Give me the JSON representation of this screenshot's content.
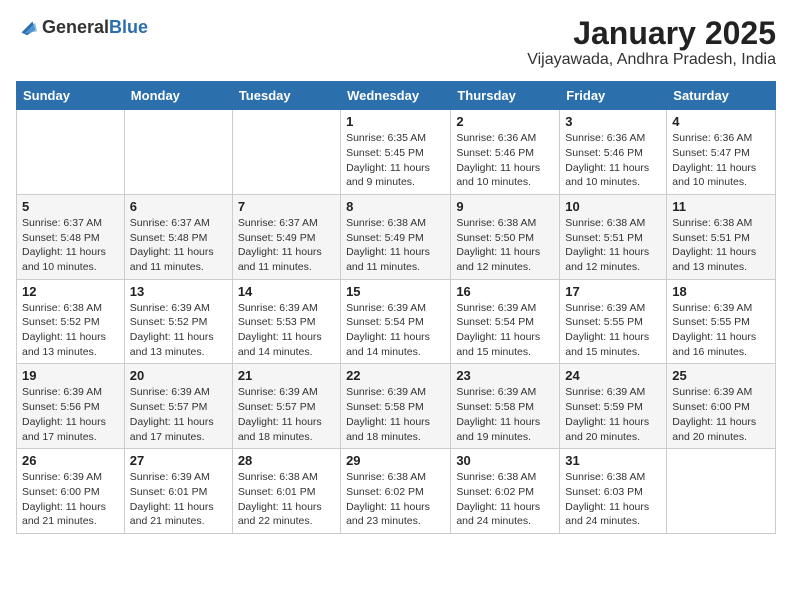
{
  "header": {
    "logo_general": "General",
    "logo_blue": "Blue",
    "title": "January 2025",
    "subtitle": "Vijayawada, Andhra Pradesh, India"
  },
  "days_of_week": [
    "Sunday",
    "Monday",
    "Tuesday",
    "Wednesday",
    "Thursday",
    "Friday",
    "Saturday"
  ],
  "weeks": [
    [
      {
        "day": "",
        "info": ""
      },
      {
        "day": "",
        "info": ""
      },
      {
        "day": "",
        "info": ""
      },
      {
        "day": "1",
        "info": "Sunrise: 6:35 AM\nSunset: 5:45 PM\nDaylight: 11 hours\nand 9 minutes."
      },
      {
        "day": "2",
        "info": "Sunrise: 6:36 AM\nSunset: 5:46 PM\nDaylight: 11 hours\nand 10 minutes."
      },
      {
        "day": "3",
        "info": "Sunrise: 6:36 AM\nSunset: 5:46 PM\nDaylight: 11 hours\nand 10 minutes."
      },
      {
        "day": "4",
        "info": "Sunrise: 6:36 AM\nSunset: 5:47 PM\nDaylight: 11 hours\nand 10 minutes."
      }
    ],
    [
      {
        "day": "5",
        "info": "Sunrise: 6:37 AM\nSunset: 5:48 PM\nDaylight: 11 hours\nand 10 minutes."
      },
      {
        "day": "6",
        "info": "Sunrise: 6:37 AM\nSunset: 5:48 PM\nDaylight: 11 hours\nand 11 minutes."
      },
      {
        "day": "7",
        "info": "Sunrise: 6:37 AM\nSunset: 5:49 PM\nDaylight: 11 hours\nand 11 minutes."
      },
      {
        "day": "8",
        "info": "Sunrise: 6:38 AM\nSunset: 5:49 PM\nDaylight: 11 hours\nand 11 minutes."
      },
      {
        "day": "9",
        "info": "Sunrise: 6:38 AM\nSunset: 5:50 PM\nDaylight: 11 hours\nand 12 minutes."
      },
      {
        "day": "10",
        "info": "Sunrise: 6:38 AM\nSunset: 5:51 PM\nDaylight: 11 hours\nand 12 minutes."
      },
      {
        "day": "11",
        "info": "Sunrise: 6:38 AM\nSunset: 5:51 PM\nDaylight: 11 hours\nand 13 minutes."
      }
    ],
    [
      {
        "day": "12",
        "info": "Sunrise: 6:38 AM\nSunset: 5:52 PM\nDaylight: 11 hours\nand 13 minutes."
      },
      {
        "day": "13",
        "info": "Sunrise: 6:39 AM\nSunset: 5:52 PM\nDaylight: 11 hours\nand 13 minutes."
      },
      {
        "day": "14",
        "info": "Sunrise: 6:39 AM\nSunset: 5:53 PM\nDaylight: 11 hours\nand 14 minutes."
      },
      {
        "day": "15",
        "info": "Sunrise: 6:39 AM\nSunset: 5:54 PM\nDaylight: 11 hours\nand 14 minutes."
      },
      {
        "day": "16",
        "info": "Sunrise: 6:39 AM\nSunset: 5:54 PM\nDaylight: 11 hours\nand 15 minutes."
      },
      {
        "day": "17",
        "info": "Sunrise: 6:39 AM\nSunset: 5:55 PM\nDaylight: 11 hours\nand 15 minutes."
      },
      {
        "day": "18",
        "info": "Sunrise: 6:39 AM\nSunset: 5:55 PM\nDaylight: 11 hours\nand 16 minutes."
      }
    ],
    [
      {
        "day": "19",
        "info": "Sunrise: 6:39 AM\nSunset: 5:56 PM\nDaylight: 11 hours\nand 17 minutes."
      },
      {
        "day": "20",
        "info": "Sunrise: 6:39 AM\nSunset: 5:57 PM\nDaylight: 11 hours\nand 17 minutes."
      },
      {
        "day": "21",
        "info": "Sunrise: 6:39 AM\nSunset: 5:57 PM\nDaylight: 11 hours\nand 18 minutes."
      },
      {
        "day": "22",
        "info": "Sunrise: 6:39 AM\nSunset: 5:58 PM\nDaylight: 11 hours\nand 18 minutes."
      },
      {
        "day": "23",
        "info": "Sunrise: 6:39 AM\nSunset: 5:58 PM\nDaylight: 11 hours\nand 19 minutes."
      },
      {
        "day": "24",
        "info": "Sunrise: 6:39 AM\nSunset: 5:59 PM\nDaylight: 11 hours\nand 20 minutes."
      },
      {
        "day": "25",
        "info": "Sunrise: 6:39 AM\nSunset: 6:00 PM\nDaylight: 11 hours\nand 20 minutes."
      }
    ],
    [
      {
        "day": "26",
        "info": "Sunrise: 6:39 AM\nSunset: 6:00 PM\nDaylight: 11 hours\nand 21 minutes."
      },
      {
        "day": "27",
        "info": "Sunrise: 6:39 AM\nSunset: 6:01 PM\nDaylight: 11 hours\nand 21 minutes."
      },
      {
        "day": "28",
        "info": "Sunrise: 6:38 AM\nSunset: 6:01 PM\nDaylight: 11 hours\nand 22 minutes."
      },
      {
        "day": "29",
        "info": "Sunrise: 6:38 AM\nSunset: 6:02 PM\nDaylight: 11 hours\nand 23 minutes."
      },
      {
        "day": "30",
        "info": "Sunrise: 6:38 AM\nSunset: 6:02 PM\nDaylight: 11 hours\nand 24 minutes."
      },
      {
        "day": "31",
        "info": "Sunrise: 6:38 AM\nSunset: 6:03 PM\nDaylight: 11 hours\nand 24 minutes."
      },
      {
        "day": "",
        "info": ""
      }
    ]
  ]
}
